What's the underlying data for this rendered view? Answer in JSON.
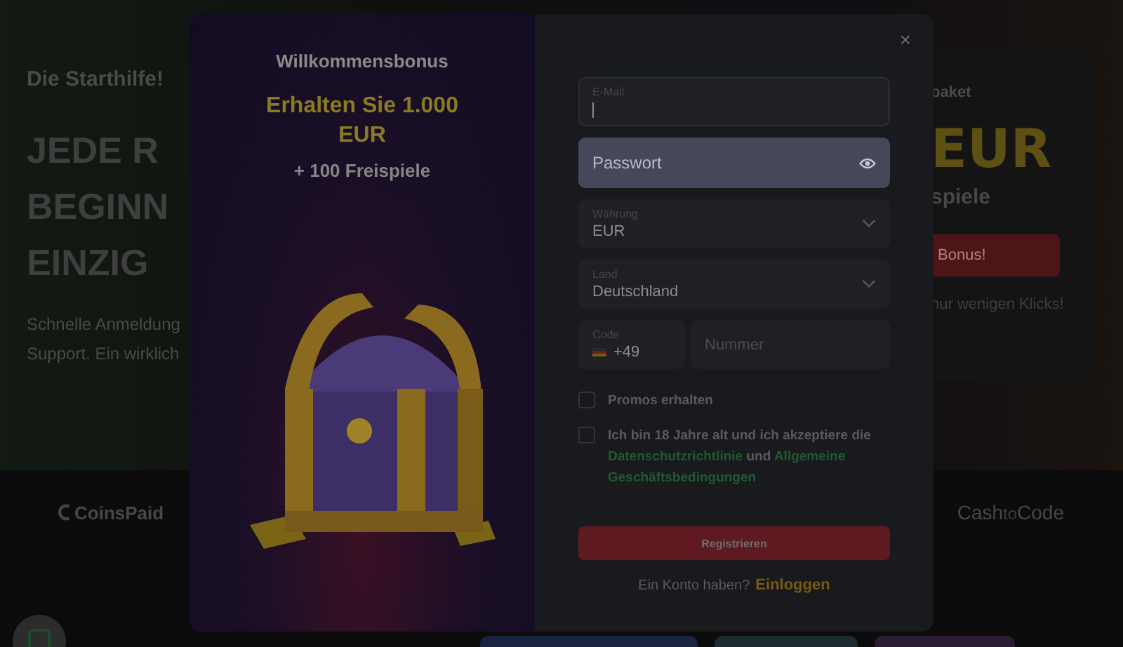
{
  "background": {
    "intro_label": "Die Starthilfe!",
    "headline_lines": [
      "JEDE R",
      "BEGINN",
      "EINZIG"
    ],
    "description_lines": [
      "Schnelle Anmeldung",
      "Support. Ein wirklich"
    ],
    "promo_card": {
      "label": "paket",
      "amount": "EUR",
      "spins": "spiele",
      "button": "Bonus!",
      "hint": "nur wenigen Klicks!"
    },
    "payment_logos": [
      {
        "kind": "coinspaid",
        "text": "CoinsPaid"
      },
      {
        "kind": "cashtocode",
        "parts": [
          "Cash",
          "to",
          "Code"
        ]
      }
    ]
  },
  "modal": {
    "close": "×",
    "bonus": {
      "title": "Willkommensbonus",
      "offer_lines": [
        "Erhalten Sie 1.000",
        "EUR"
      ],
      "spins": "+ 100 Freispiele"
    },
    "fields": [
      {
        "kind": "text",
        "label": "E-Mail",
        "focused": true,
        "highlighted": false
      },
      {
        "kind": "password",
        "placeholder": "Passwort",
        "focused": false,
        "highlighted": true
      },
      {
        "kind": "select",
        "label": "Währung",
        "value": "EUR",
        "focused": false,
        "highlighted": false
      },
      {
        "kind": "select",
        "label": "Land",
        "value": "Deutschland",
        "focused": false,
        "highlighted": false
      }
    ],
    "phone": {
      "code_label": "Code",
      "code_value": "+49",
      "number_placeholder": "Nummer"
    },
    "checkboxes": [
      {
        "checked": false,
        "parts": [
          {
            "kind": "text",
            "text": "Promos erhalten"
          }
        ]
      },
      {
        "checked": false,
        "parts": [
          {
            "kind": "text",
            "text": "Ich bin 18 Jahre alt und ich akzeptiere die"
          },
          {
            "kind": "link",
            "text": "Datenschutzrichtlinie"
          },
          {
            "kind": "text",
            "text": "und"
          },
          {
            "kind": "link",
            "text": "Allgemeine"
          },
          {
            "kind": "link",
            "text": "Geschäftsbedingungen"
          }
        ]
      }
    ],
    "submit": "Registrieren",
    "login_prompt": "Ein Konto haben?",
    "login_link": "Einloggen"
  }
}
